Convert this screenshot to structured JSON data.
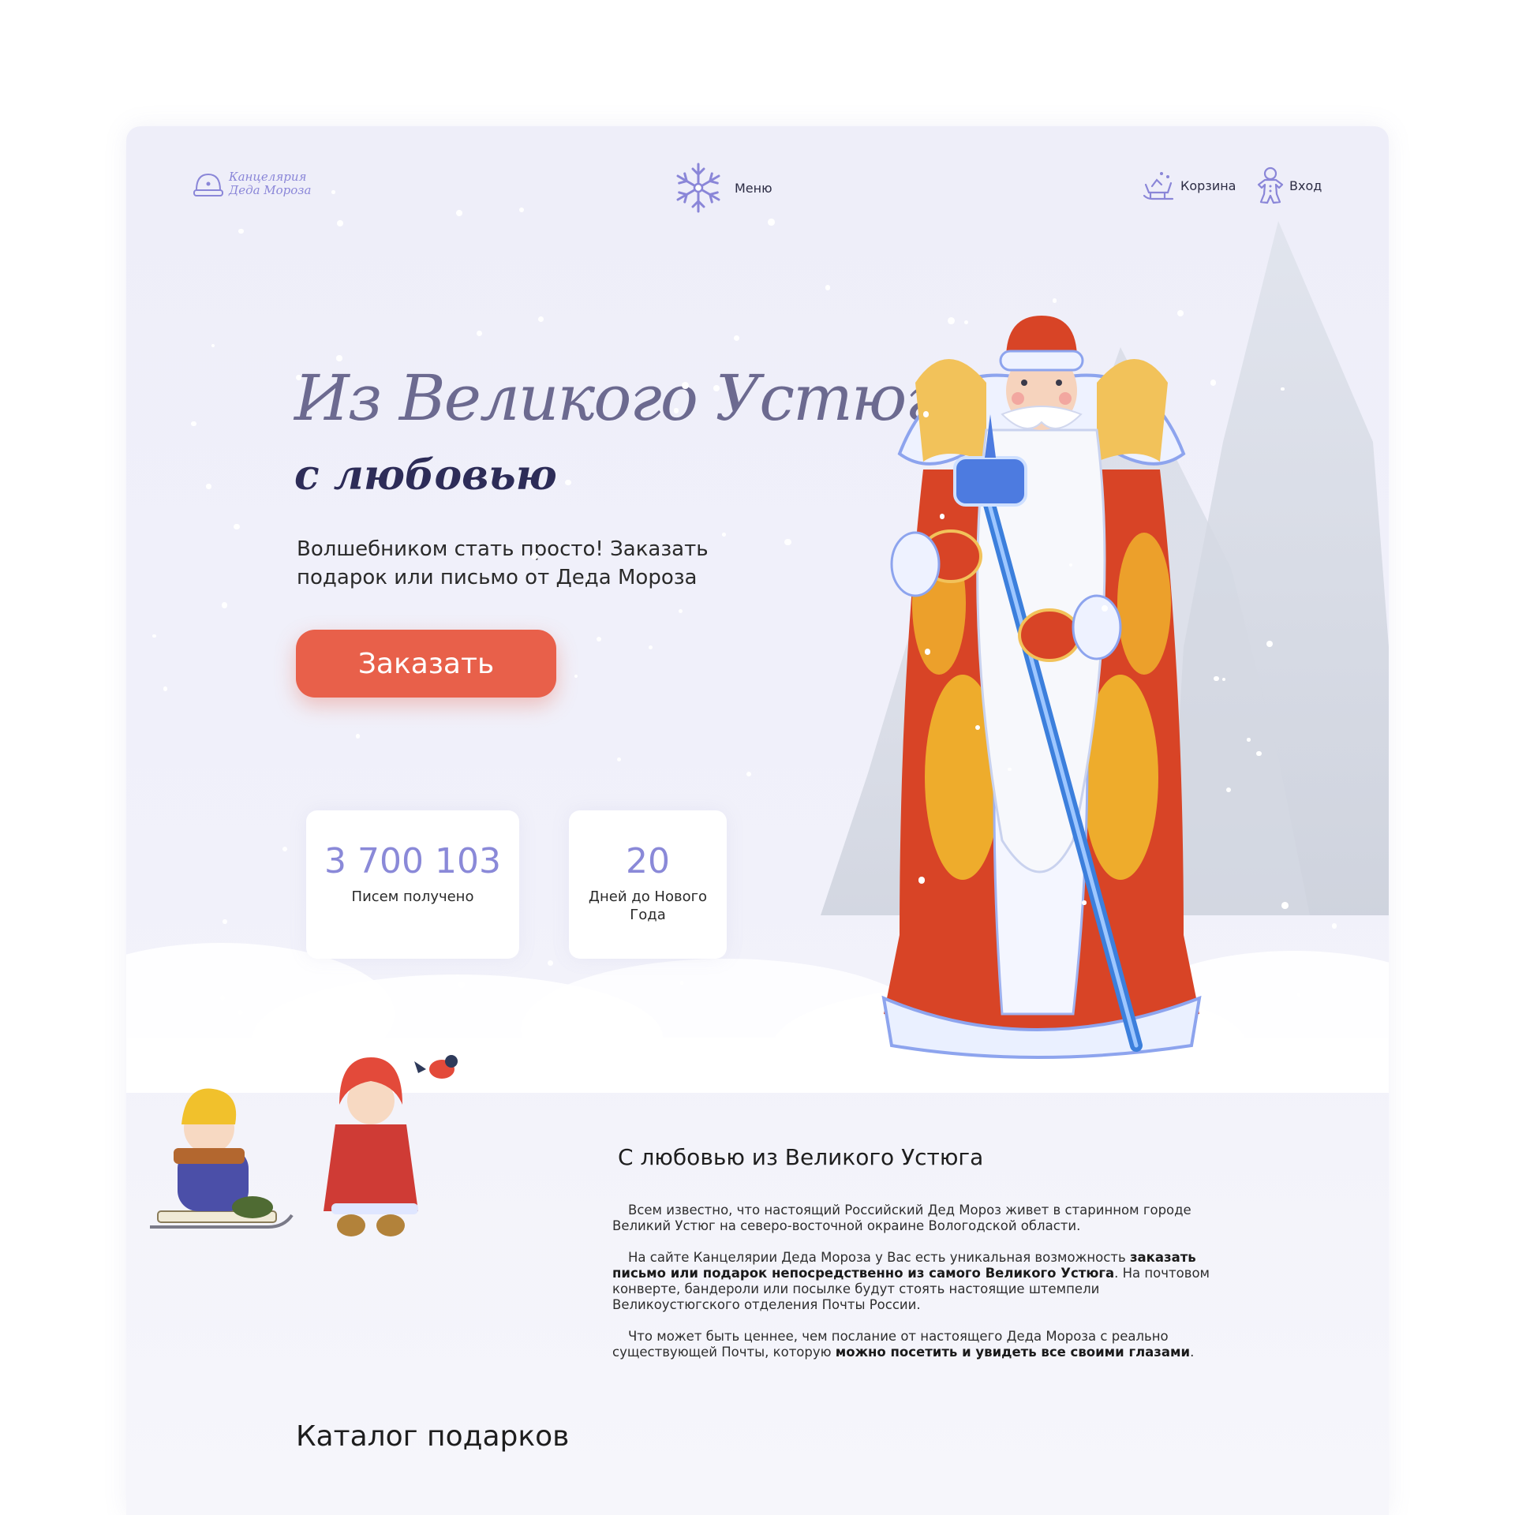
{
  "header": {
    "logo_line1": "Канцелярия",
    "logo_line2": "Деда Мороза",
    "menu_label": "Меню",
    "cart_label": "Корзина",
    "login_label": "Вход"
  },
  "hero": {
    "title": "Из Великого Устюга",
    "subtitle": "с любовью",
    "description": "Волшебником стать просто!  Заказать подарок или письмо от Деда Мороза",
    "cta_label": "Заказать"
  },
  "stats": [
    {
      "value": "3 700 103",
      "label": "Писем получено"
    },
    {
      "value": "20",
      "label": "Дней до Нового Года"
    }
  ],
  "about": {
    "title": "С любовью из Великого Устюга",
    "p1": "Всем известно, что настоящий Российский Дед Мороз живет в старинном городе Великий Устюг на северо-восточной окраине Вологодской области.",
    "p2_a": "На сайте Канцелярии Деда Мороза у Вас есть уникальная возможность ",
    "p2_b": "заказать письмо или подарок непосредственно из самого Великого Устюга",
    "p2_c": ". На почтовом конверте, бандероли или посылке будут стоять настоящие штемпели Великоустюгского отделения Почты России.",
    "p3_a": "Что может быть ценнее, чем послание от настоящего Деда Мороза с реально существующей Почты, которую ",
    "p3_b": "можно посетить и увидеть все своими глазами",
    "p3_c": "."
  },
  "catalog": {
    "title": "Каталог подарков"
  },
  "colors": {
    "accent": "#e8604a",
    "stat_number": "#8a89d8",
    "title_gradient_top": "#8f8cb0",
    "title_dark": "#2d2c58",
    "icon_purple": "#8a86d8"
  },
  "icons": [
    "snowglobe-logo-icon",
    "snowflake-icon",
    "sleigh-icon",
    "gingerbread-icon"
  ]
}
